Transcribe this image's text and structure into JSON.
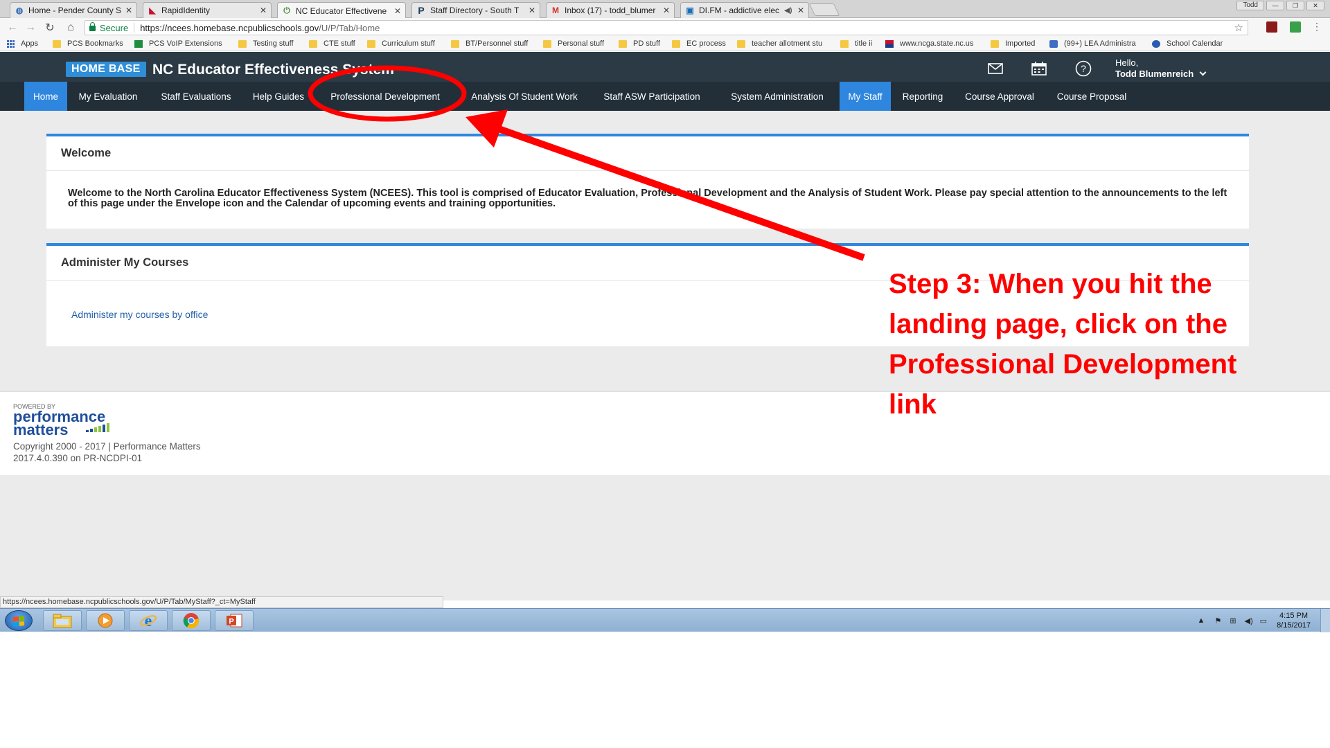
{
  "browser": {
    "tabs": [
      {
        "title": "Home - Pender County S",
        "icon": "globe-icon",
        "active": false
      },
      {
        "title": "RapidIdentity",
        "icon": "rapididentity-icon",
        "active": false
      },
      {
        "title": "NC Educator Effectivene",
        "icon": "homebase-icon",
        "active": true
      },
      {
        "title": "Staff Directory - South T",
        "icon": "p-icon",
        "active": false
      },
      {
        "title": "Inbox (17) - todd_blumer",
        "icon": "gmail-icon",
        "active": false
      },
      {
        "title": "DI.FM - addictive elec",
        "icon": "difm-icon",
        "active": false
      }
    ],
    "user_chip": "Todd",
    "address": {
      "secure_label": "Secure",
      "url_host": "https://ncees.homebase.ncpublicschools.gov",
      "url_path": "/U/P/Tab/Home"
    },
    "bookmarks": [
      {
        "label": "Apps",
        "icon": "apps-grid-icon"
      },
      {
        "label": "PCS Bookmarks",
        "icon": "folder-icon"
      },
      {
        "label": "PCS VoIP Extensions",
        "icon": "sheet-icon"
      },
      {
        "label": "Testing stuff",
        "icon": "folder-icon"
      },
      {
        "label": "CTE stuff",
        "icon": "folder-icon"
      },
      {
        "label": "Curriculum stuff",
        "icon": "folder-icon"
      },
      {
        "label": "BT/Personnel stuff",
        "icon": "folder-icon"
      },
      {
        "label": "Personal stuff",
        "icon": "folder-icon"
      },
      {
        "label": "PD stuff",
        "icon": "folder-icon"
      },
      {
        "label": "EC process",
        "icon": "folder-icon"
      },
      {
        "label": "teacher allotment stu",
        "icon": "folder-icon"
      },
      {
        "label": "title ii",
        "icon": "folder-icon"
      },
      {
        "label": "www.ncga.state.nc.us",
        "icon": "ncga-icon"
      },
      {
        "label": "Imported",
        "icon": "folder-icon"
      },
      {
        "label": "(99+) LEA Administra",
        "icon": "chat-icon"
      },
      {
        "label": "School Calendar",
        "icon": "calendar-globe-icon"
      }
    ]
  },
  "app": {
    "logo": "HOME BASE",
    "title": "NC Educator Effectiveness System",
    "greeting": "Hello,",
    "user_name": "Todd Blumenreich",
    "header_icons": [
      "mail-icon",
      "calendar-icon",
      "help-icon"
    ]
  },
  "nav": [
    {
      "label": "Home",
      "active": true
    },
    {
      "label": "My Evaluation",
      "active": false
    },
    {
      "label": "Staff Evaluations",
      "active": false
    },
    {
      "label": "Help Guides",
      "active": false
    },
    {
      "label": "Professional Development",
      "active": false
    },
    {
      "label": "Analysis Of Student Work",
      "active": false
    },
    {
      "label": "Staff ASW Participation",
      "active": false
    },
    {
      "label": "System Administration",
      "active": false
    },
    {
      "label": "My Staff",
      "active": true
    },
    {
      "label": "Reporting",
      "active": false
    },
    {
      "label": "Course Approval",
      "active": false
    },
    {
      "label": "Course Proposal",
      "active": false
    }
  ],
  "welcome": {
    "heading": "Welcome",
    "body": "Welcome to the North Carolina Educator Effectiveness System (NCEES).  This tool is comprised of Educator Evaluation, Professional Development and the Analysis of Student Work.   Please pay special attention to the announcements to the left of this page under the Envelope icon and the Calendar of upcoming events and training opportunities."
  },
  "courses": {
    "heading": "Administer My Courses",
    "link": "Administer my courses by office"
  },
  "footer": {
    "powered_by": "POWERED BY",
    "brand_line1": "performance",
    "brand_line2": "matters",
    "copyright": "Copyright 2000 - 2017 | Performance Matters",
    "version": "2017.4.0.390 on PR-NCDPI-01"
  },
  "status_url": "https://ncees.homebase.ncpublicschools.gov/U/P/Tab/MyStaff?_ct=MyStaff",
  "taskbar": {
    "apps": [
      "explorer-icon",
      "media-player-icon",
      "internet-explorer-icon",
      "chrome-icon",
      "powerpoint-icon"
    ],
    "time": "4:15 PM",
    "date": "8/15/2017"
  },
  "annotation": {
    "lines": [
      "Step 3: When you hit the",
      "landing page, click on the",
      "Professional Development",
      "link"
    ],
    "color": "#ff0000"
  },
  "colors": {
    "header": "#2b3a45",
    "nav": "#222f39",
    "accent": "#2e86de",
    "annotation": "#ff0000"
  }
}
